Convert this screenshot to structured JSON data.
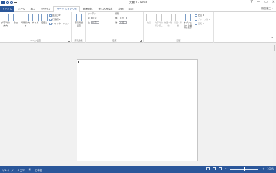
{
  "window": {
    "title": "文書 1 - Word",
    "help": "?",
    "minimize": "—",
    "maximize": "▭",
    "close": "✕",
    "user": "岡田 康二 ▾"
  },
  "tabs": {
    "file": "ファイル",
    "items": [
      "ホーム",
      "挿入",
      "デザイン",
      "ページ レイアウト",
      "参考資料",
      "差し込み文書",
      "校閲",
      "表示"
    ],
    "active_index": 3
  },
  "ribbon": {
    "page_setup": {
      "text_direction": "文字列の方向",
      "margins": "余白",
      "orientation": "印刷の向き",
      "size": "サイズ",
      "columns": "段組み",
      "breaks": "区切り ▾",
      "line_numbers": "行番号 ▾",
      "hyphenation": "ハイフネーション ▾",
      "label": "ページ設定"
    },
    "manuscript": {
      "settings": "原稿用紙設定",
      "label": "原稿用紙"
    },
    "paragraph": {
      "indent_head": "インデント",
      "spacing_head": "間隔",
      "left_label": "左:",
      "left_value": "0 字",
      "right_label": "右:",
      "right_value": "0 字",
      "before_label": "前:",
      "before_value": "0 行",
      "after_label": "後:",
      "after_value": "0 行",
      "label": "段落"
    },
    "arrange": {
      "position": "位置",
      "wrap_text": "文字列の折り返し",
      "bring_forward": "前面へ移動",
      "send_backward": "背面へ移動",
      "selection_pane": "オブジェクトの選択と表示",
      "align": "配置 ▾",
      "group": "グループ化 ▾",
      "rotate": "回転 ▾",
      "label": "配置"
    }
  },
  "status": {
    "page": "1/1 ページ",
    "words": "0 文字",
    "language": "日本語",
    "zoom": "100%",
    "zoom_minus": "−",
    "zoom_plus": "+"
  }
}
